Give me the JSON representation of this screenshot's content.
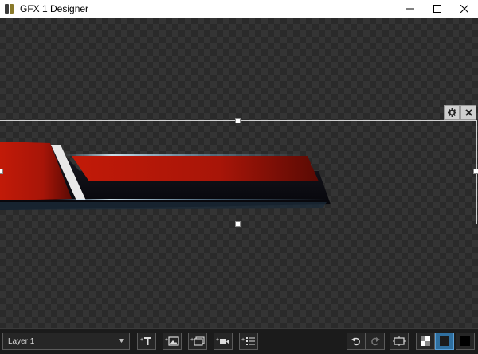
{
  "window": {
    "title": "GFX 1 Designer",
    "controls": [
      "minimize-icon",
      "maximize-icon",
      "close-icon"
    ]
  },
  "canvas": {
    "background": "checkerboard",
    "layer_tools": [
      "gear-icon",
      "close-icon"
    ]
  },
  "colors": {
    "accent_blue": "#2f6f9f",
    "graphic_red": "#b01a0a",
    "toolbar_bg": "#1b1b1b"
  },
  "toolbar": {
    "layer_select": {
      "value": "Layer 1"
    },
    "add_buttons": [
      "add-text-icon",
      "add-image-icon",
      "add-slideshow-icon",
      "add-video-icon",
      "add-list-icon"
    ],
    "history_buttons": [
      "undo-icon",
      "redo-icon"
    ],
    "frame_button": "safe-area-icon",
    "background_buttons": [
      "transparent-background-icon",
      "blue-background-icon",
      "black-background-icon"
    ],
    "active_background": "blue-background-icon"
  }
}
